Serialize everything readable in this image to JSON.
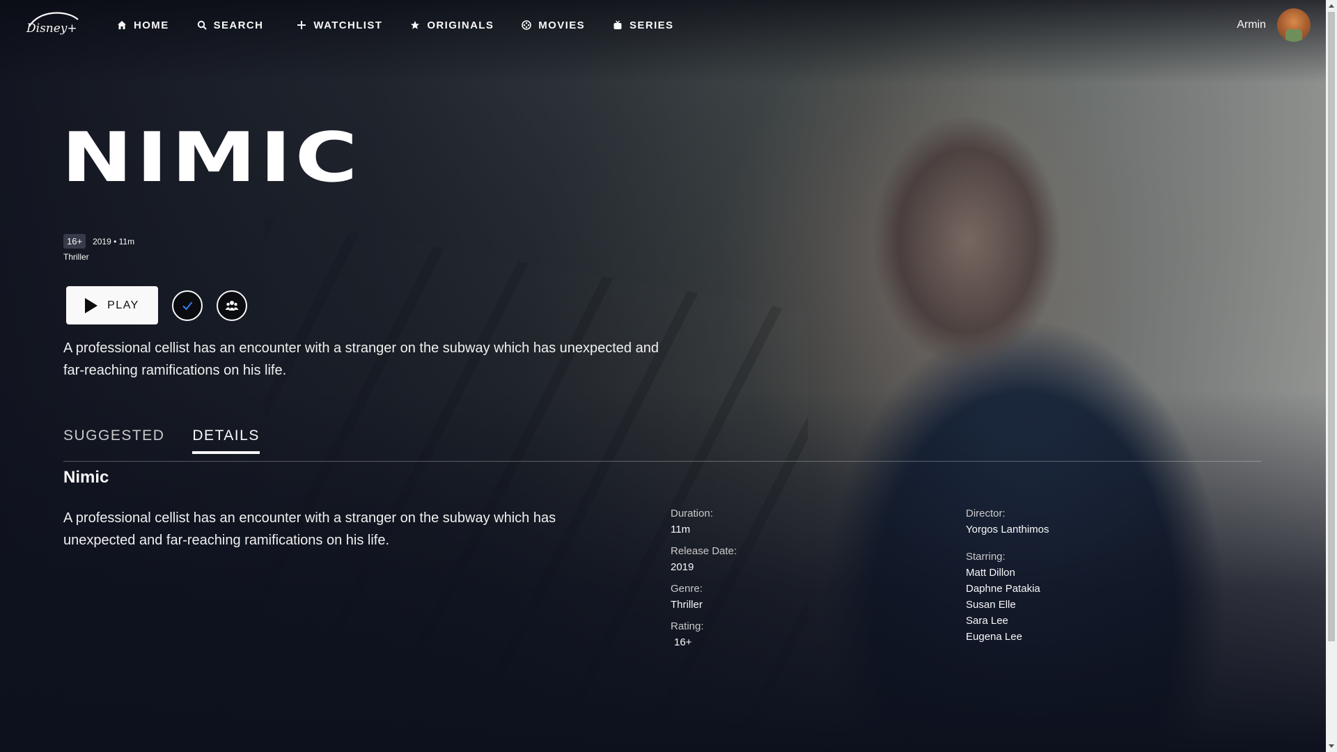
{
  "header": {
    "logo_text": "Disney+",
    "nav": [
      {
        "label": "HOME",
        "icon": "home-icon"
      },
      {
        "label": "SEARCH",
        "icon": "search-icon"
      },
      {
        "label": "WATCHLIST",
        "icon": "plus-icon"
      },
      {
        "label": "ORIGINALS",
        "icon": "star-icon"
      },
      {
        "label": "MOVIES",
        "icon": "film-reel-icon"
      },
      {
        "label": "SERIES",
        "icon": "tv-icon"
      }
    ],
    "user_name": "Armin"
  },
  "title": {
    "logo_text": "NIMIC",
    "rating_badge": "16+",
    "year_duration": "2019 • 11m",
    "genre": "Thriller"
  },
  "actions": {
    "play_label": "PLAY",
    "watchlist_icon": "check-icon",
    "groupwatch_icon": "group-icon"
  },
  "description": "A professional cellist has an encounter with a stranger on the subway which has unexpected and far-reaching ramifications on his life.",
  "tabs": [
    {
      "label": "SUGGESTED",
      "active": false
    },
    {
      "label": "DETAILS",
      "active": true
    }
  ],
  "details": {
    "title": "Nimic",
    "description": "A professional cellist has an encounter with a stranger on the subway which has unexpected and far-reaching ramifications on his life.",
    "duration_label": "Duration:",
    "duration": "11m",
    "release_label": "Release Date:",
    "release": "2019",
    "genre_label": "Genre:",
    "genre": "Thriller",
    "rating_label": "Rating:",
    "rating": "16+",
    "director_label": "Director:",
    "director": "Yorgos Lanthimos",
    "starring_label": "Starring:",
    "starring": [
      "Matt Dillon",
      "Daphne Patakia",
      "Susan Elle",
      "Sara Lee",
      "Eugena Lee"
    ]
  },
  "colors": {
    "background": "#0d111e",
    "text": "#f9f9f9",
    "accent_check": "#3b7cf0"
  }
}
